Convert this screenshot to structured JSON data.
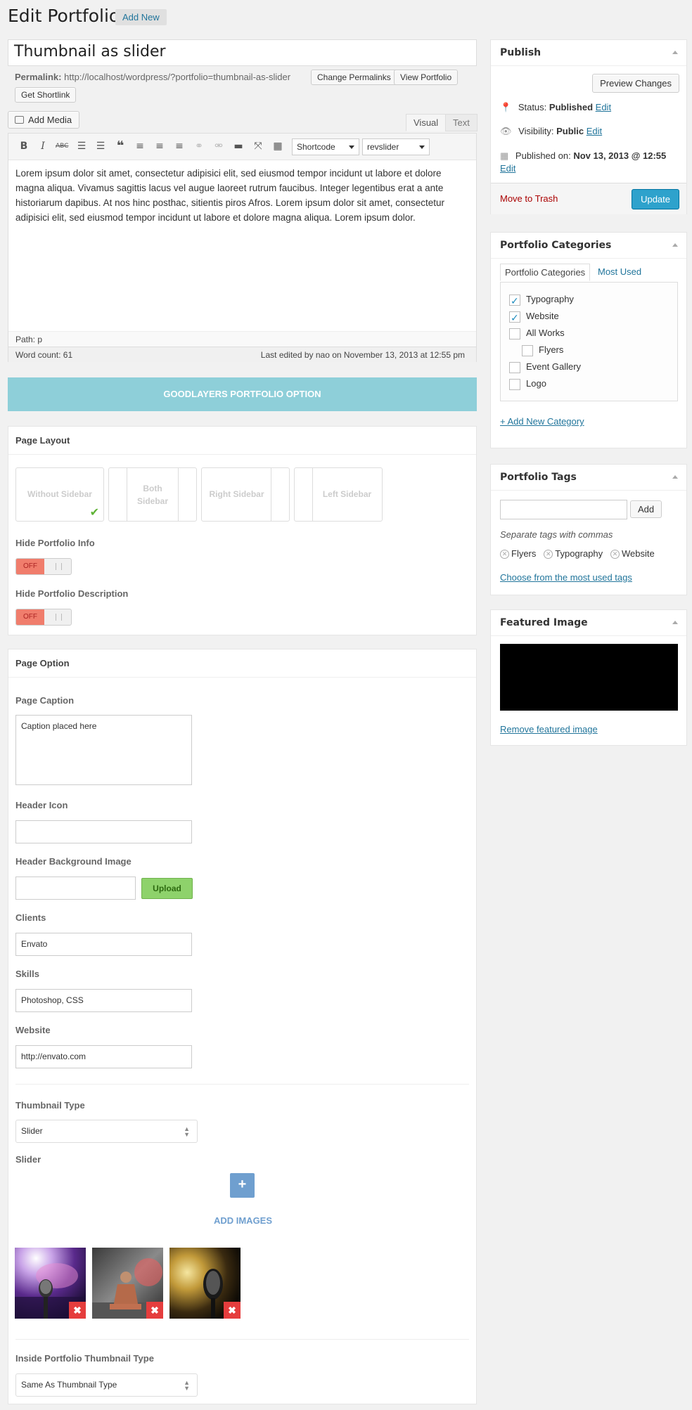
{
  "page": {
    "title": "Edit Portfolio",
    "add_new": "Add New"
  },
  "post": {
    "title": "Thumbnail as slider",
    "permalink_label": "Permalink:",
    "permalink_url": "http://localhost/wordpress/?portfolio=thumbnail-as-slider",
    "change_permalinks": "Change Permalinks",
    "view_portfolio": "View Portfolio",
    "get_shortlink": "Get Shortlink"
  },
  "editor": {
    "add_media": "Add Media",
    "tab_visual": "Visual",
    "tab_text": "Text",
    "shortcode_select": "Shortcode",
    "revslider_select": "revslider",
    "content": "Lorem ipsum dolor sit amet, consectetur adipisici elit, sed eiusmod tempor incidunt ut labore et dolore magna aliqua. Vivamus sagittis lacus vel augue laoreet rutrum faucibus. Integer legentibus erat a ante historiarum dapibus. At nos hinc posthac, sitientis piros Afros. Lorem ipsum dolor sit amet, consectetur adipisici elit, sed eiusmod tempor incidunt ut labore et dolore magna aliqua. Lorem ipsum dolor.",
    "path": "Path: p",
    "word_count": "Word count: 61",
    "last_edited": "Last edited by nao on November 13, 2013 at 12:55 pm"
  },
  "goodlayers_bar": "GOODLAYERS PORTFOLIO OPTION",
  "page_layout": {
    "heading": "Page Layout",
    "options": [
      "Without Sidebar",
      "Both Sidebar",
      "Right Sidebar",
      "Left Sidebar"
    ],
    "hide_info_label": "Hide Portfolio Info",
    "hide_info_value": "OFF",
    "hide_desc_label": "Hide Portfolio Description",
    "hide_desc_value": "OFF"
  },
  "page_option": {
    "heading": "Page Option",
    "caption_label": "Page Caption",
    "caption_value": "Caption placed here",
    "header_icon_label": "Header Icon",
    "header_bg_label": "Header Background Image",
    "upload": "Upload",
    "clients_label": "Clients",
    "clients_value": "Envato",
    "skills_label": "Skills",
    "skills_value": "Photoshop, CSS",
    "website_label": "Website",
    "website_value": "http://envato.com",
    "thumb_type_label": "Thumbnail Type",
    "thumb_type_value": "Slider",
    "slider_label": "Slider",
    "add_images": "ADD IMAGES",
    "inside_thumb_label": "Inside Portfolio Thumbnail Type",
    "inside_thumb_value": "Same As Thumbnail Type"
  },
  "publish": {
    "heading": "Publish",
    "preview": "Preview Changes",
    "status_label": "Status:",
    "status_value": "Published",
    "visibility_label": "Visibility:",
    "visibility_value": "Public",
    "published_label": "Published on:",
    "published_value": "Nov 13, 2013 @ 12:55",
    "edit": "Edit",
    "trash": "Move to Trash",
    "update": "Update"
  },
  "categories": {
    "heading": "Portfolio Categories",
    "tab_all": "Portfolio Categories",
    "tab_used": "Most Used",
    "items": [
      "Typography",
      "Website",
      "All Works",
      "Flyers",
      "Event Gallery",
      "Logo"
    ],
    "add_new": "+ Add New Category"
  },
  "tags": {
    "heading": "Portfolio Tags",
    "add": "Add",
    "hint": "Separate tags with commas",
    "items": [
      "Flyers",
      "Typography",
      "Website"
    ],
    "choose": "Choose from the most used tags"
  },
  "featured": {
    "heading": "Featured Image",
    "remove": "Remove featured image"
  },
  "colors": {
    "accent": "#21759b",
    "goodlayers": "#8ecfd9",
    "update_btn": "#2ea2cc",
    "off_toggle": "#f07d6c",
    "upload_btn": "#8ed26b"
  }
}
